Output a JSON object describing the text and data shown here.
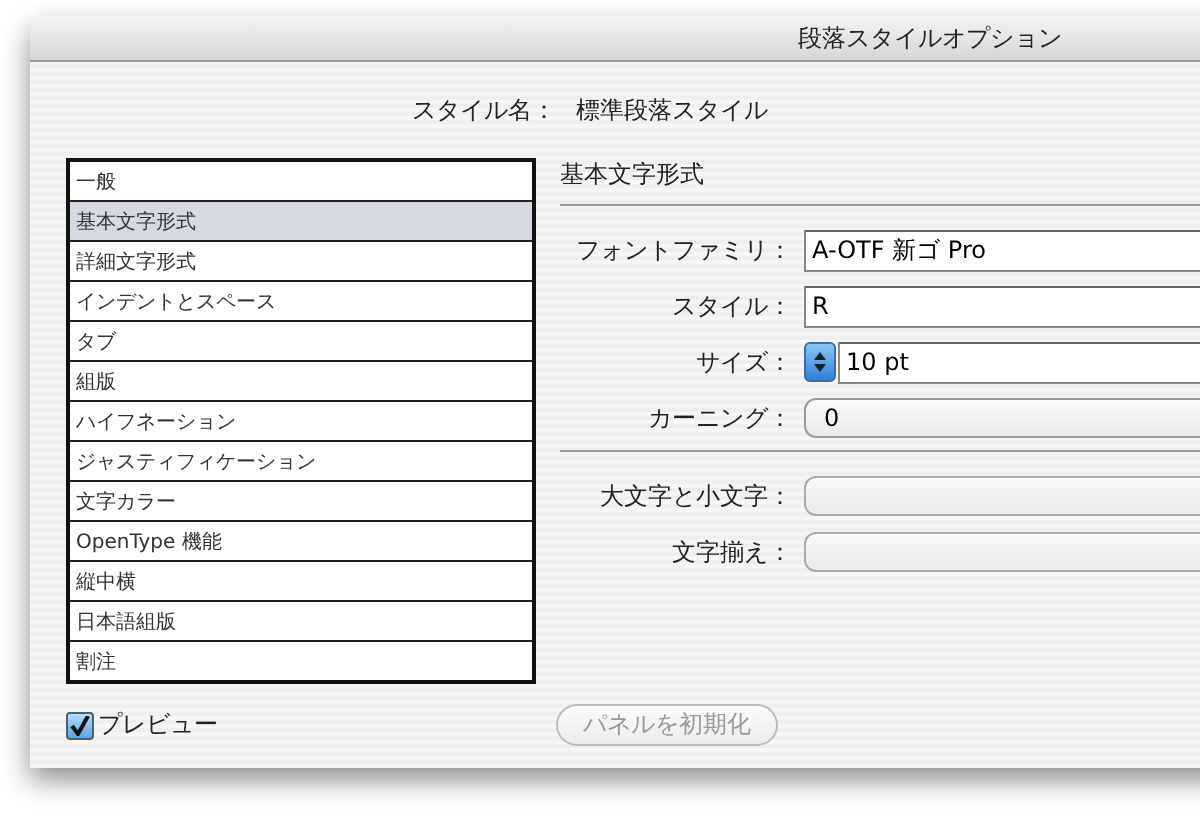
{
  "window": {
    "title": "段落スタイルオプション"
  },
  "style_name": {
    "label": "スタイル名：",
    "value": "標準段落スタイル"
  },
  "categories": [
    {
      "label": "一般",
      "selected": false
    },
    {
      "label": "基本文字形式",
      "selected": true
    },
    {
      "label": "詳細文字形式",
      "selected": false
    },
    {
      "label": "インデントとスペース",
      "selected": false
    },
    {
      "label": "タブ",
      "selected": false
    },
    {
      "label": "組版",
      "selected": false
    },
    {
      "label": "ハイフネーション",
      "selected": false
    },
    {
      "label": "ジャスティフィケーション",
      "selected": false
    },
    {
      "label": "文字カラー",
      "selected": false
    },
    {
      "label": "OpenType 機能",
      "selected": false
    },
    {
      "label": "縦中横",
      "selected": false
    },
    {
      "label": "日本語組版",
      "selected": false
    },
    {
      "label": "割注",
      "selected": false
    }
  ],
  "section_title": "基本文字形式",
  "field_groups": [
    [
      {
        "kind": "text",
        "label": "フォントファミリ：",
        "value": "A-OTF 新ゴ Pro"
      },
      {
        "kind": "text",
        "label": "スタイル：",
        "value": "R"
      },
      {
        "kind": "spinner",
        "label": "サイズ：",
        "value": "10 pt"
      },
      {
        "kind": "combo",
        "label": "カーニング：",
        "value": "0"
      }
    ],
    [
      {
        "kind": "combo",
        "label": "大文字と小文字："
      },
      {
        "kind": "combo",
        "label": "文字揃え："
      }
    ]
  ],
  "preview": {
    "label": "プレビュー",
    "checked": true
  },
  "reset_button": {
    "label": "パネルを初期化",
    "disabled": true
  }
}
